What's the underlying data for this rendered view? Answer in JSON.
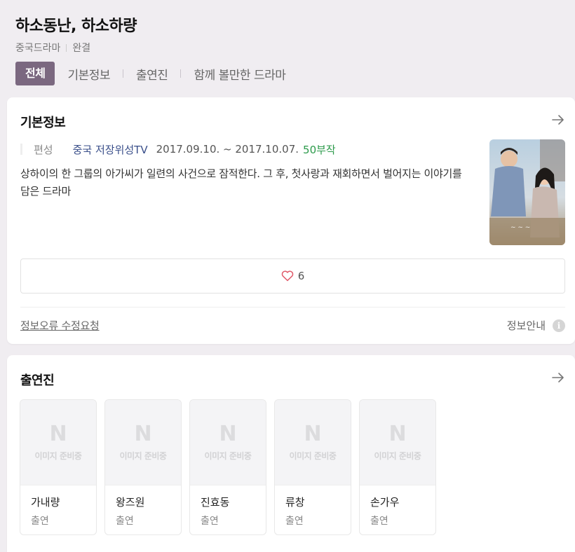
{
  "header": {
    "title": "하소동난, 하소하량",
    "genre": "중국드라마",
    "status": "완결"
  },
  "tabs": [
    {
      "label": "전체"
    },
    {
      "label": "기본정보"
    },
    {
      "label": "출연진"
    },
    {
      "label": "함께 볼만한 드라마"
    }
  ],
  "basic": {
    "title": "기본정보",
    "label": "편성",
    "channel": "중국 저장위성TV",
    "dates": "2017.09.10. ~ 2017.10.07.",
    "episodes": "50부작",
    "synopsis": "상하이의 한 그룹의 아가씨가 일련의 사건으로 잠적한다. 그 후, 첫사랑과 재회하면서 벌어지는 이야기를 담은 드라마",
    "likes": "6",
    "report": "정보오류 수정요청",
    "guide": "정보안내"
  },
  "cast_section": {
    "title": "출연진",
    "placeholder_letter": "N",
    "placeholder_text": "이미지 준비중",
    "members": [
      {
        "name": "가내량",
        "role": "출연"
      },
      {
        "name": "왕즈원",
        "role": "출연"
      },
      {
        "name": "진효동",
        "role": "출연"
      },
      {
        "name": "류창",
        "role": "출연"
      },
      {
        "name": "손가우",
        "role": "출연"
      }
    ]
  },
  "colors": {
    "accent": "#7b6880",
    "channel": "#3a4f8a",
    "episodes": "#2b9a4a",
    "heart": "#e05a6a"
  }
}
